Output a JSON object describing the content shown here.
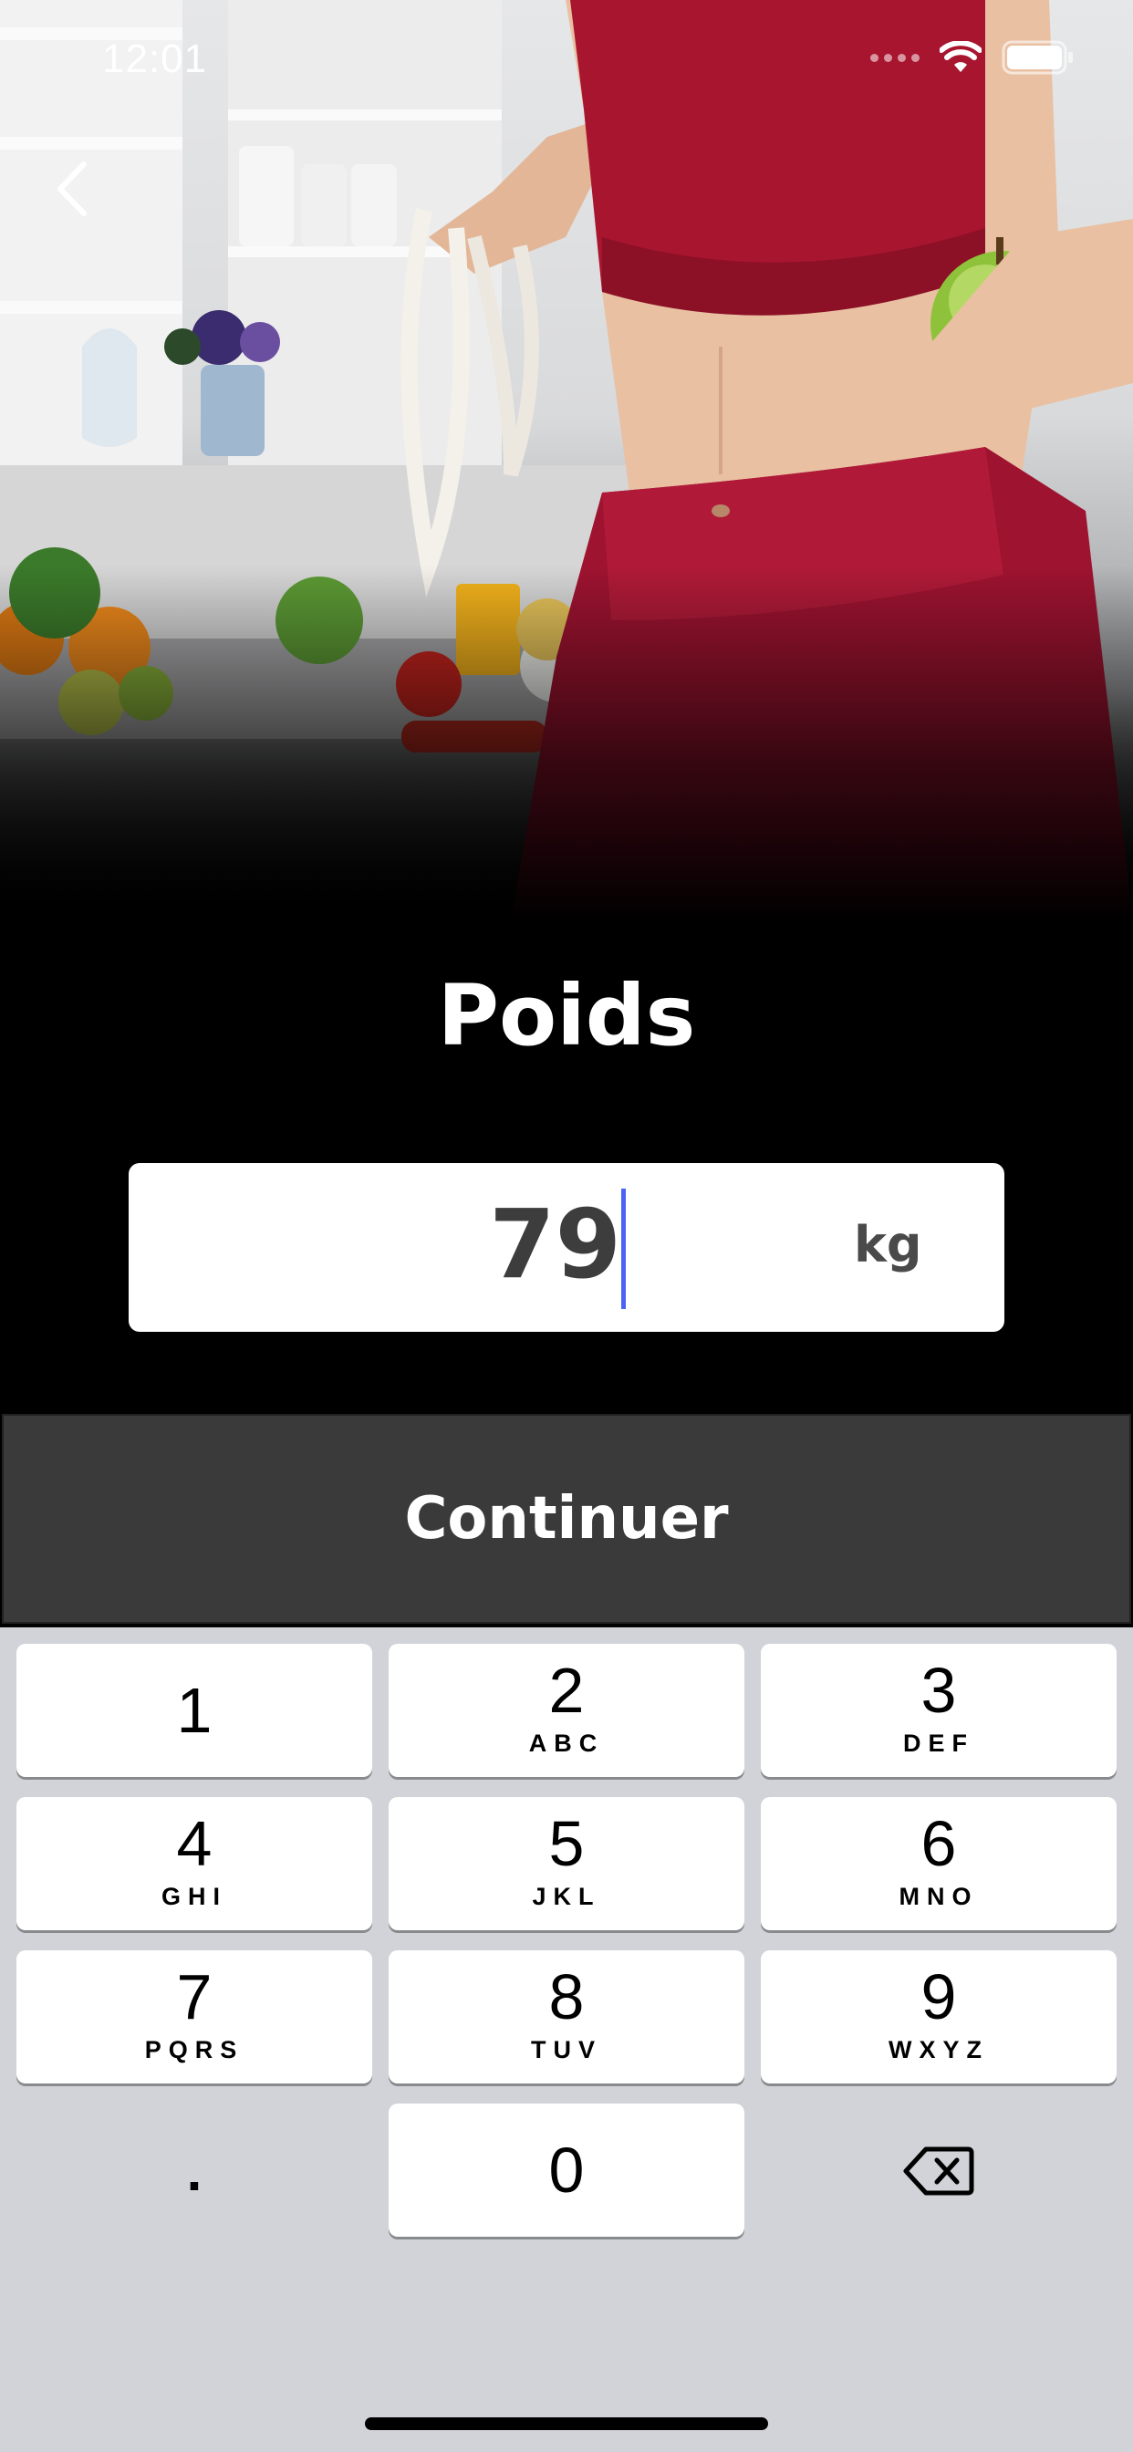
{
  "status_bar": {
    "time": "12:01"
  },
  "nav": {
    "back_icon": "chevron-left-icon"
  },
  "screen": {
    "title": "Poids",
    "weight_input": {
      "value": "79",
      "unit": "kg"
    },
    "continue_label": "Continuer"
  },
  "keypad": {
    "keys": [
      {
        "num": "1",
        "letters": ""
      },
      {
        "num": "2",
        "letters": "ABC"
      },
      {
        "num": "3",
        "letters": "DEF"
      },
      {
        "num": "4",
        "letters": "GHI"
      },
      {
        "num": "5",
        "letters": "JKL"
      },
      {
        "num": "6",
        "letters": "MNO"
      },
      {
        "num": "7",
        "letters": "PQRS"
      },
      {
        "num": "8",
        "letters": "TUV"
      },
      {
        "num": "9",
        "letters": "WXYZ"
      },
      {
        "num": "0",
        "letters": ""
      }
    ],
    "decimal_key": ".",
    "delete_icon": "backspace-icon"
  },
  "colors": {
    "caret": "#4a63f2",
    "button_bg": "#3a3a3a",
    "keypad_bg": "#d1d3d9"
  }
}
